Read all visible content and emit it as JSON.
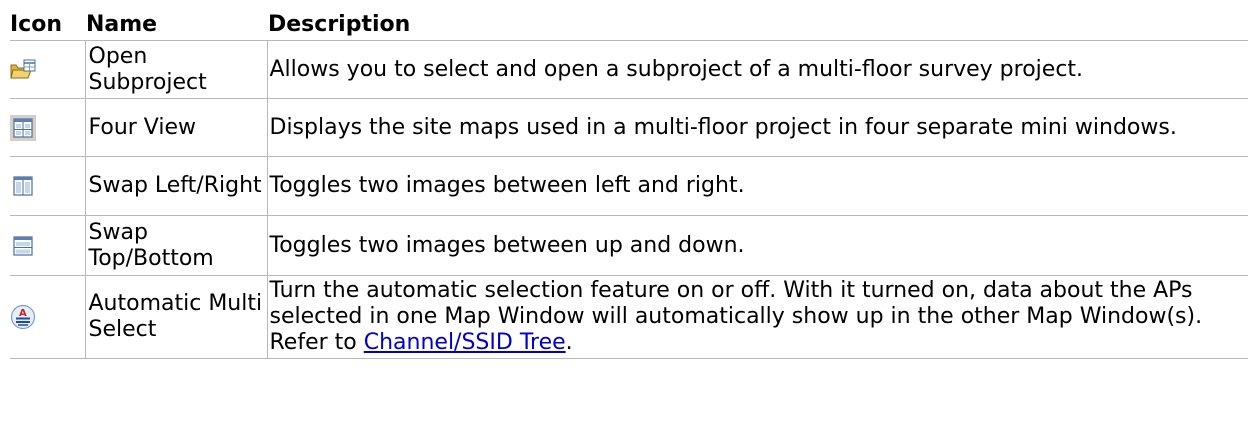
{
  "headers": {
    "icon": "Icon",
    "name": "Name",
    "description": "Description"
  },
  "rows": [
    {
      "icon": "open-subproject-icon",
      "name": "Open Subproject",
      "description": "Allows you to select and open a subproject of a multi-floor survey project."
    },
    {
      "icon": "four-view-icon",
      "name": "Four View",
      "description": "Displays the site maps used in a multi-floor project in four separate mini windows."
    },
    {
      "icon": "swap-left-right-icon",
      "name": "Swap Left/Right",
      "description": "Toggles two images between left and right."
    },
    {
      "icon": "swap-top-bottom-icon",
      "name": "Swap Top/Bottom",
      "description": "Toggles two images between up and down."
    },
    {
      "icon": "automatic-multi-select-icon",
      "name": "Automatic Multi Select",
      "description_text": "Turn the automatic selection feature on or off. With it turned on, data about the APs selected in one Map Window will automatically show up in the other Map Window(s). Refer to ",
      "link_text": "Channel/SSID Tree",
      "description_end": "."
    }
  ],
  "colors": {
    "border": "#b8b8b8",
    "link": "#0000cc",
    "icon_blue": "#7a9cc6",
    "folder_yellow": "#e0b43c"
  }
}
